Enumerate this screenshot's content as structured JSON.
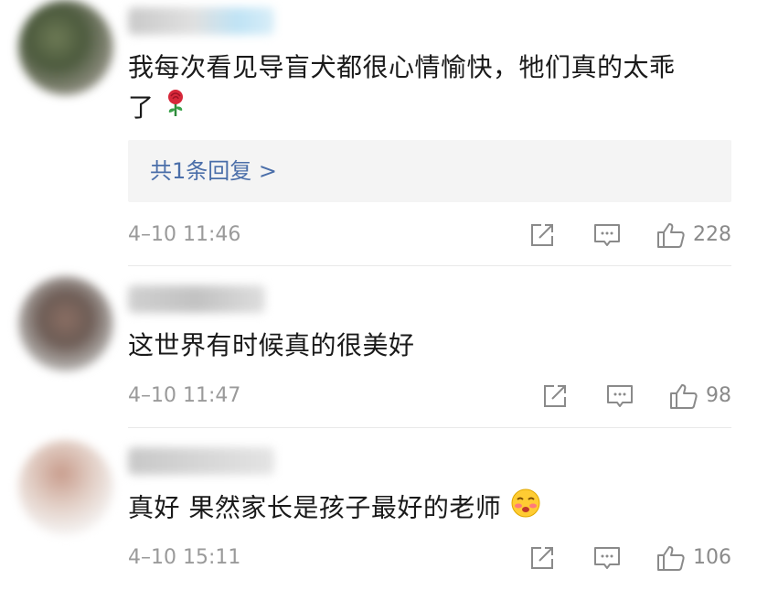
{
  "comments": [
    {
      "text_line1": "我每次看见导盲犬都很心情愉快，牠们真的太乖",
      "text_line2": "了",
      "emoji": "rose-icon",
      "reply_link": "共1条回复 >",
      "time": "4–10 11:46",
      "likes": "228"
    },
    {
      "text": "这世界有时候真的很美好",
      "time": "4–10 11:47",
      "likes": "98"
    },
    {
      "text": "真好 果然家长是孩子最好的老师",
      "emoji": "blush-face-icon",
      "time": "4–10 15:11",
      "likes": "106"
    }
  ],
  "colors": {
    "link": "#4a6ea9",
    "meta": "#9a9a9a",
    "reply_bg": "#f4f4f4",
    "divider": "#e9e9e9"
  }
}
